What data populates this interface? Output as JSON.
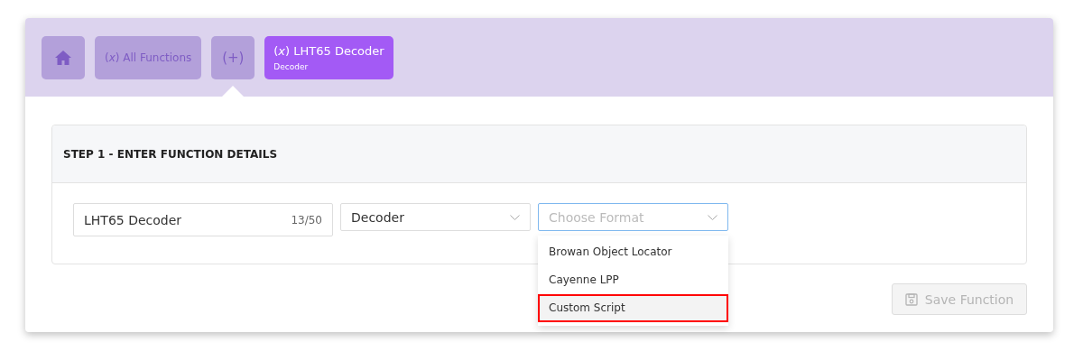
{
  "breadcrumbs": [
    {
      "kind": "home",
      "selected": false
    },
    {
      "kind": "link",
      "label": "(*x*) All Functions",
      "selected": false
    },
    {
      "kind": "link",
      "label": "(+)",
      "selected": true
    },
    {
      "kind": "current",
      "label": "(*x*) LHT65 Decoder",
      "sublabel": "Decoder",
      "selected": false
    }
  ],
  "step": {
    "title": "STEP 1 - ENTER FUNCTION DETAILS",
    "name_field": {
      "value": "LHT65 Decoder",
      "counter": "13/50"
    },
    "type_select": {
      "value": "Decoder"
    },
    "format_select": {
      "placeholder": "Choose Format",
      "focused": true,
      "options": [
        {
          "label": "Browan Object Locator",
          "selected": false
        },
        {
          "label": "Cayenne LPP",
          "selected": false
        },
        {
          "label": "Custom Script",
          "selected": true
        }
      ]
    }
  },
  "save_button": {
    "label": "Save Function",
    "disabled": true
  }
}
